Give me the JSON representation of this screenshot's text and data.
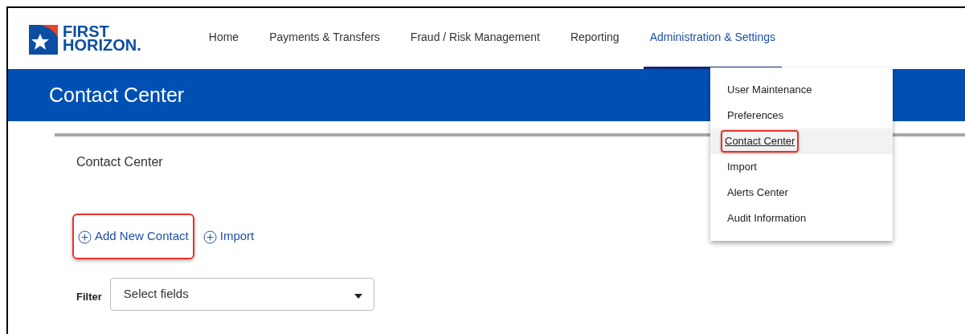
{
  "logo": {
    "line_1": "FIRST",
    "line_2": "HORIZON."
  },
  "nav": [
    {
      "label": "Home",
      "selected": false
    },
    {
      "label": "Payments & Transfers",
      "selected": false
    },
    {
      "label": "Fraud / Risk Management",
      "selected": false
    },
    {
      "label": "Reporting",
      "selected": false
    },
    {
      "label": "Administration & Settings",
      "selected": true
    }
  ],
  "page_title": "Contact Center",
  "dropdown_menu": [
    {
      "label": "User Maintenance",
      "highlighted": false
    },
    {
      "label": "Preferences",
      "highlighted": false
    },
    {
      "label": "Contact Center",
      "highlighted": true
    },
    {
      "label": "Import",
      "highlighted": false
    },
    {
      "label": "Alerts Center",
      "highlighted": false
    },
    {
      "label": "Audit Information",
      "highlighted": false
    }
  ],
  "section_title": "Contact Center",
  "actions": [
    {
      "label": "Add New Contact",
      "highlighted": true
    },
    {
      "label": "Import",
      "highlighted": false
    }
  ],
  "filter": {
    "label": "Filter",
    "placeholder": "Select fields"
  }
}
